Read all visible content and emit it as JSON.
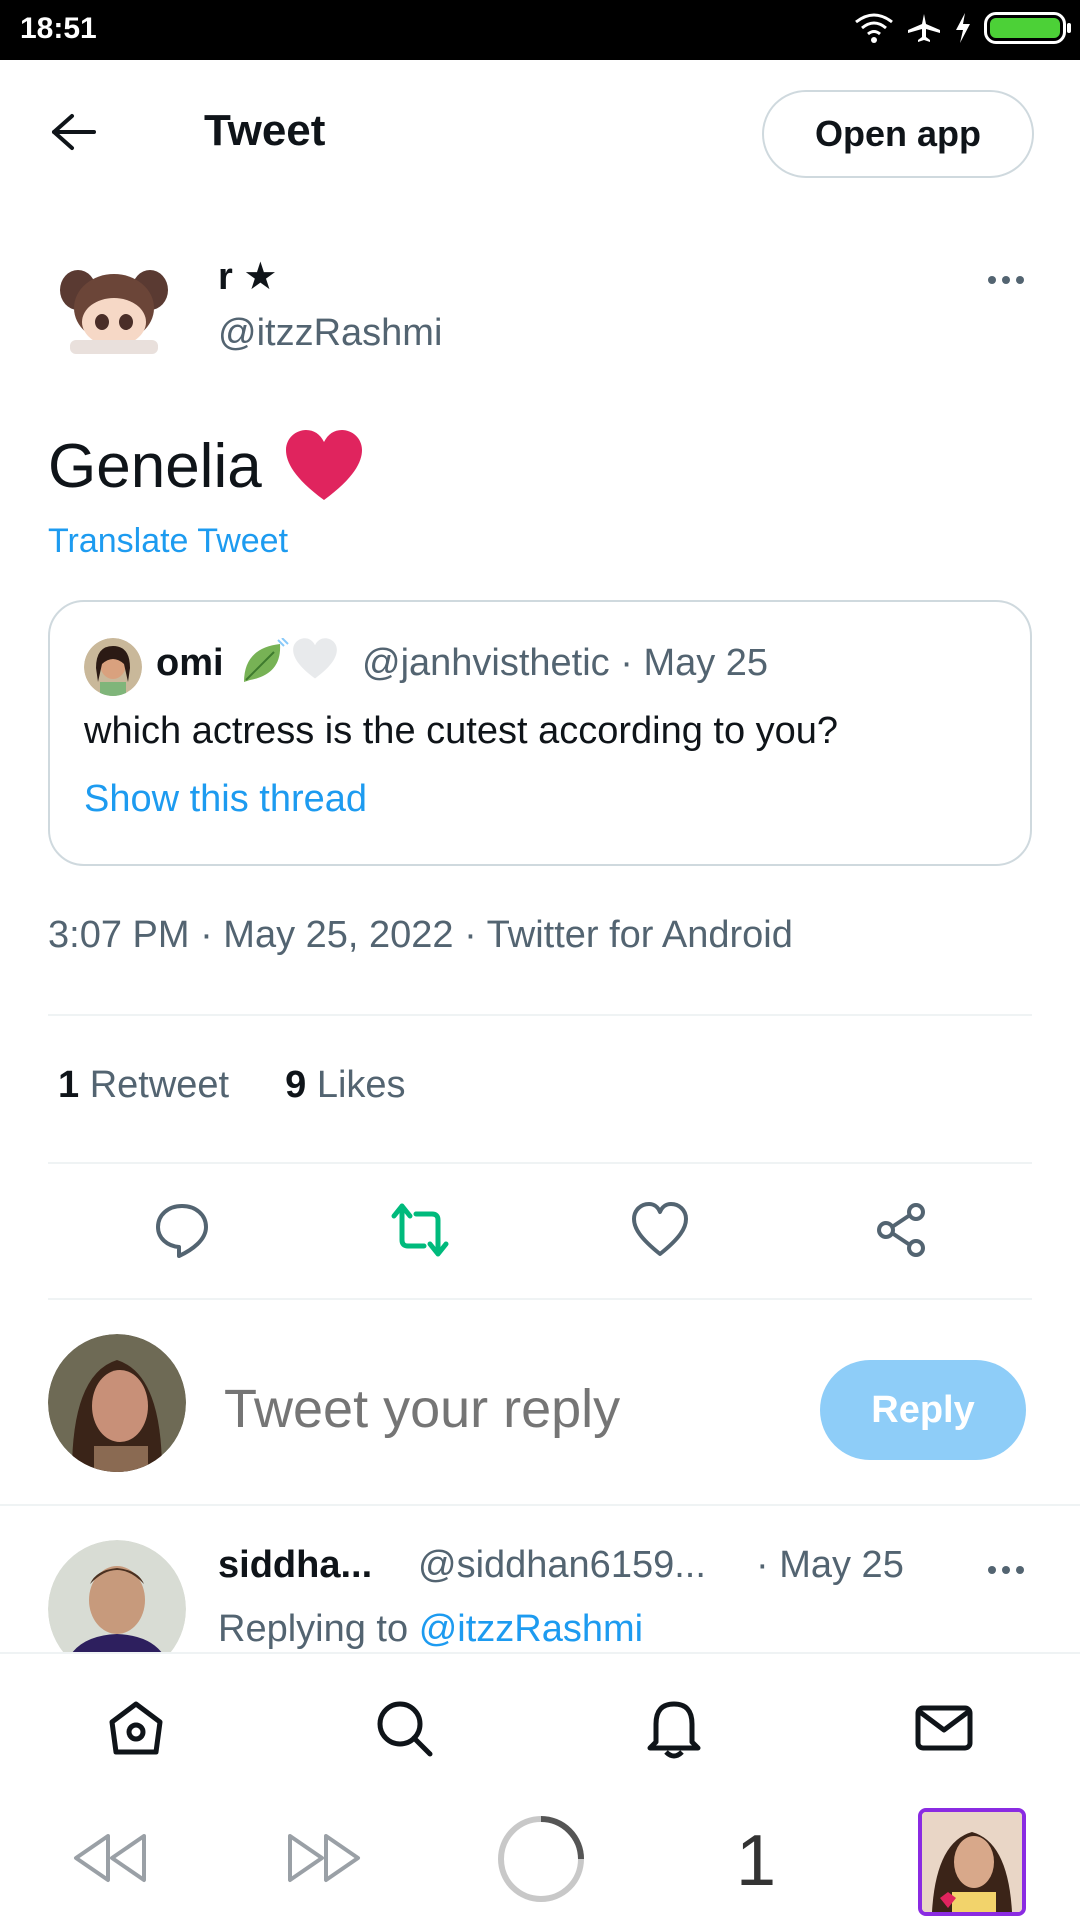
{
  "status_bar": {
    "time": "18:51"
  },
  "header": {
    "title": "Tweet",
    "open_app_label": "Open app"
  },
  "tweet": {
    "author_name": "r ★",
    "author_handle": "@itzzRashmi",
    "text": "Genelia",
    "translate_label": "Translate Tweet",
    "meta": "3:07 PM · May 25, 2022 · Twitter for Android",
    "retweet_count": "1",
    "retweet_label": "Retweet",
    "likes_count": "9",
    "likes_label": "Likes"
  },
  "quote": {
    "name": "omi",
    "handle_date": "@janhvisthetic · May 25",
    "text": "which actress is the cutest according to you?",
    "show_thread_label": "Show this thread"
  },
  "reply_box": {
    "placeholder": "Tweet your reply",
    "reply_label": "Reply"
  },
  "reply_tweet": {
    "name": "siddha...",
    "handle": "@siddhan6159...",
    "date": "· May 25",
    "replying_prefix": "Replying to",
    "replying_handle": "@itzzRashmi"
  },
  "browser": {
    "tab_count": "1"
  },
  "colors": {
    "accent": "#1d9bf0",
    "retweet_green": "#00ba7c",
    "reply_button": "#8ecdf8",
    "heart": "#e0245e"
  },
  "icons": [
    "back-arrow-icon",
    "more-icon",
    "comment-icon",
    "retweet-icon",
    "like-icon",
    "share-icon",
    "home-icon",
    "search-icon",
    "notifications-icon",
    "messages-icon"
  ]
}
